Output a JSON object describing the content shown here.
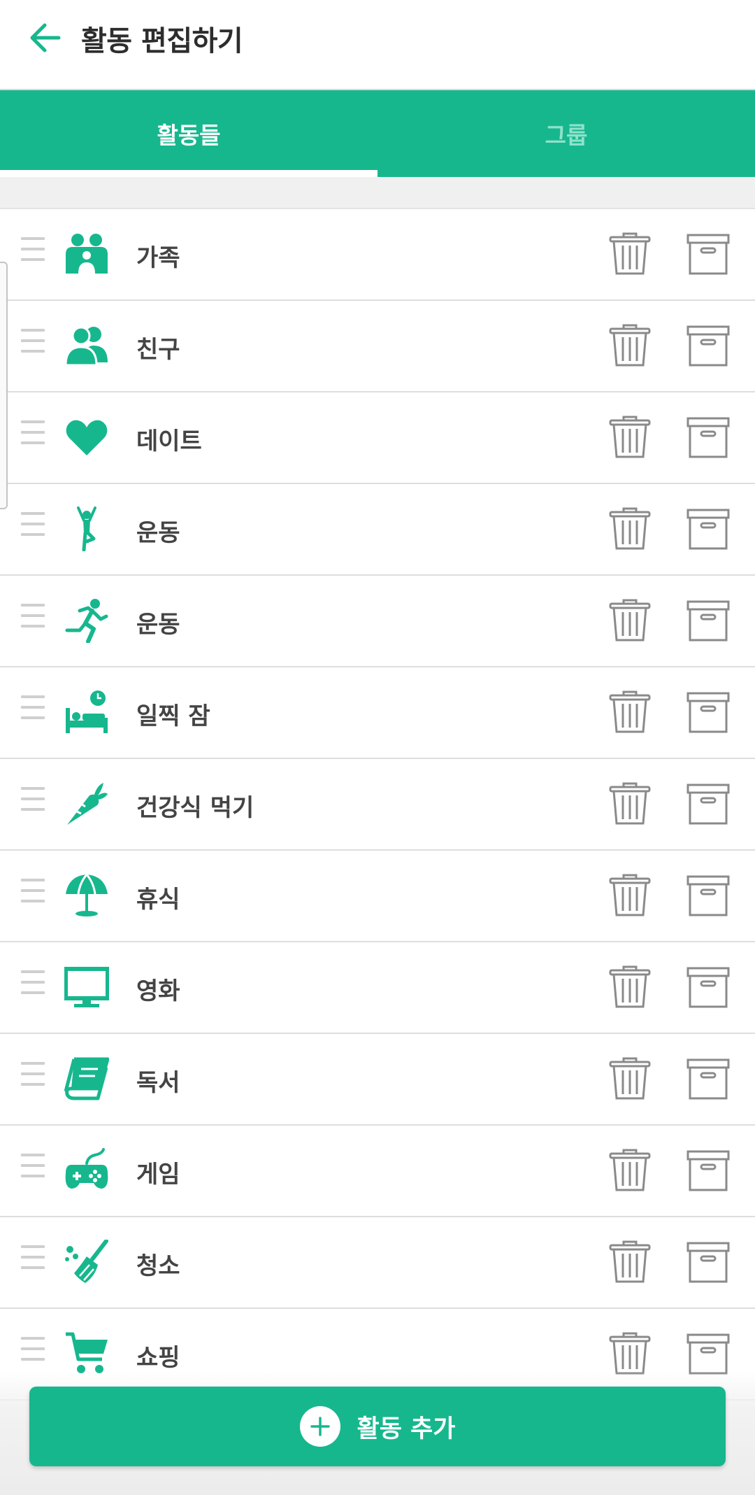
{
  "header": {
    "title": "활동 편집하기",
    "back_icon": "arrow-left-icon"
  },
  "tabs": [
    {
      "label": "활동들",
      "active": true
    },
    {
      "label": "그룹",
      "active": false
    }
  ],
  "activities": [
    {
      "label": "가족",
      "icon": "family-icon"
    },
    {
      "label": "친구",
      "icon": "friends-icon"
    },
    {
      "label": "데이트",
      "icon": "heart-icon"
    },
    {
      "label": "운동",
      "icon": "yoga-icon"
    },
    {
      "label": "운동",
      "icon": "running-icon"
    },
    {
      "label": "일찍 잠",
      "icon": "bed-clock-icon"
    },
    {
      "label": "건강식 먹기",
      "icon": "carrot-icon"
    },
    {
      "label": "휴식",
      "icon": "beach-umbrella-icon"
    },
    {
      "label": "영화",
      "icon": "monitor-icon"
    },
    {
      "label": "독서",
      "icon": "book-icon"
    },
    {
      "label": "게임",
      "icon": "gamepad-icon"
    },
    {
      "label": "청소",
      "icon": "broom-icon"
    },
    {
      "label": "쇼핑",
      "icon": "cart-icon"
    }
  ],
  "add_button": {
    "label": "활동 추가",
    "icon": "plus-circle-icon"
  },
  "colors": {
    "accent": "#17b78e",
    "tab_inactive": "#8fe2cb",
    "icon_gray": "#8a8a8a"
  }
}
